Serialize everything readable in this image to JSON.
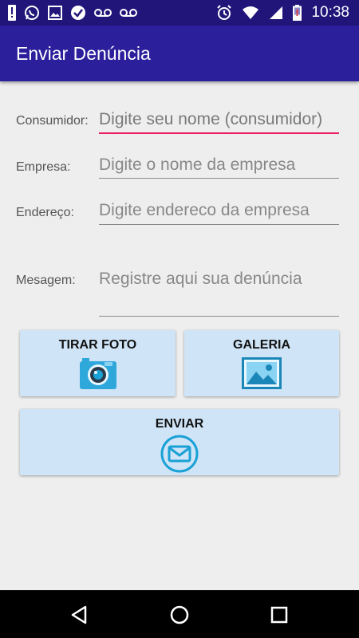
{
  "status_bar": {
    "time": "10:38",
    "left_icons": [
      "alert-icon",
      "whatsapp-icon",
      "image-icon",
      "check-circle-icon",
      "voicemail-icon",
      "voicemail-icon"
    ],
    "right_icons": [
      "alarm-icon",
      "wifi-icon",
      "signal-icon",
      "battery-icon"
    ]
  },
  "app_bar": {
    "title": "Enviar Denúncia",
    "color": "#2b1f9c"
  },
  "form": {
    "consumidor": {
      "label": "Consumidor:",
      "placeholder": "Digite seu nome (consumidor)"
    },
    "empresa": {
      "label": "Empresa:",
      "placeholder": "Digite o nome da empresa"
    },
    "endereco": {
      "label": "Endereço:",
      "placeholder": "Digite endereco da empresa"
    },
    "mensagem": {
      "label": "Mesagem:",
      "placeholder": "Registre aqui sua denúncia"
    }
  },
  "buttons": {
    "tirar_foto": {
      "label": "TIRAR FOTO",
      "icon": "camera-icon"
    },
    "galeria": {
      "label": "GALERIA",
      "icon": "gallery-icon"
    },
    "enviar": {
      "label": "ENVIAR",
      "icon": "mail-icon"
    }
  },
  "colors": {
    "accent": "#e91e63",
    "button_bg": "#cfe4f6",
    "icon_blue": "#1aa1d6"
  },
  "nav_bar": {
    "icons": [
      "back-icon",
      "home-icon",
      "recents-icon"
    ]
  }
}
